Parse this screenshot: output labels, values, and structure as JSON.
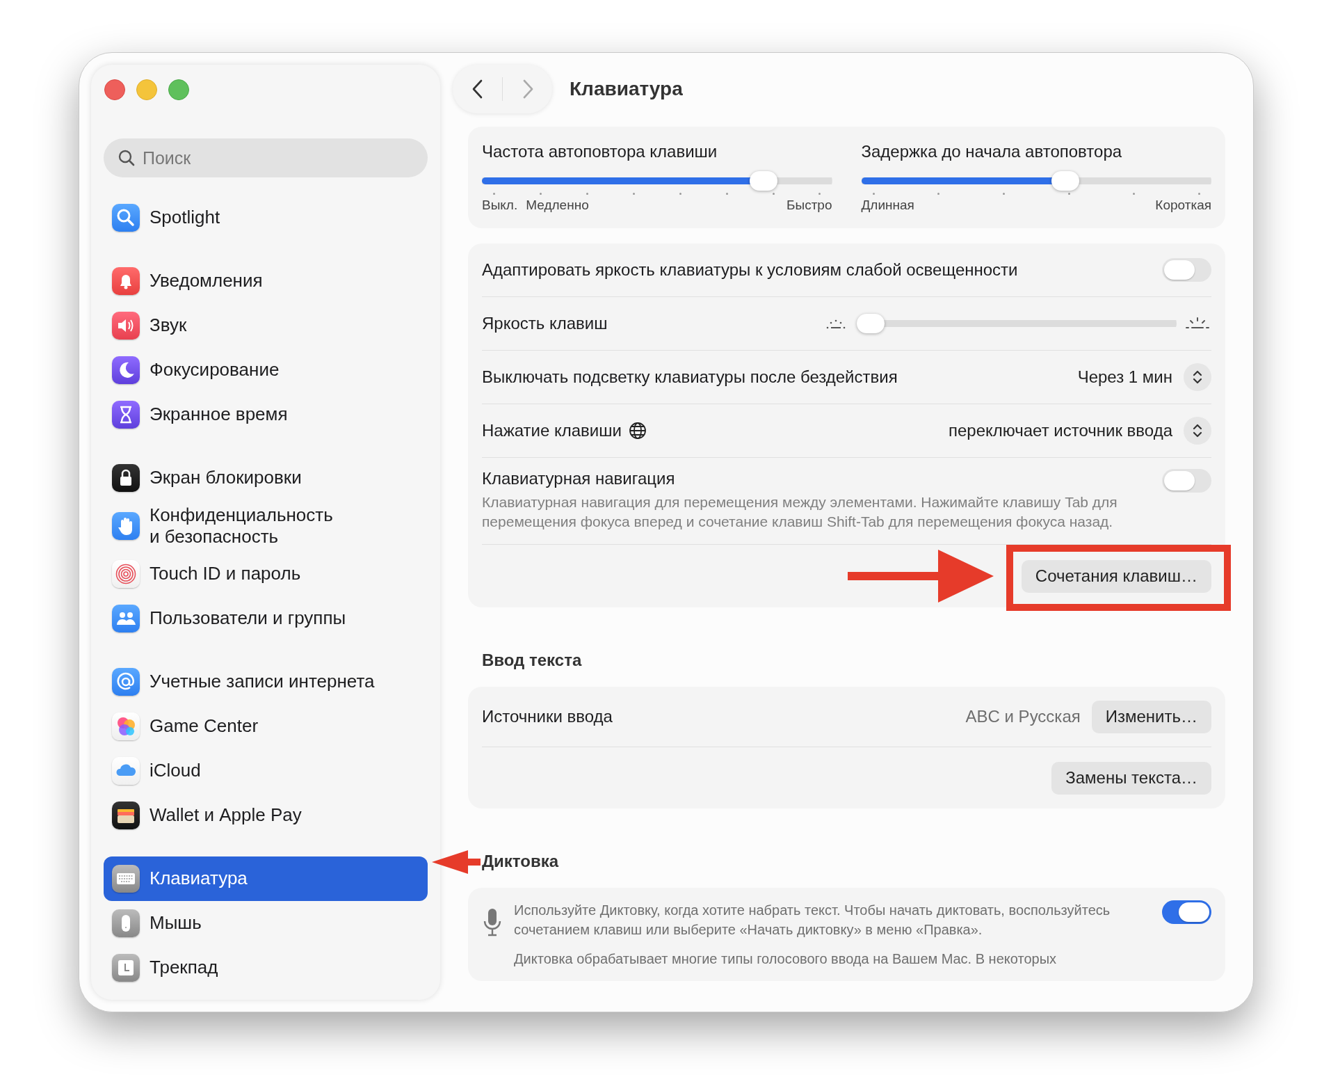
{
  "window": {
    "title": "Клавиатура"
  },
  "sidebar": {
    "search": {
      "placeholder": "Поиск"
    },
    "groups": [
      [
        {
          "label": "Spotlight",
          "kind": "spotlight",
          "selected": false
        }
      ],
      [
        {
          "label": "Уведомления",
          "kind": "notifications",
          "selected": false
        },
        {
          "label": "Звук",
          "kind": "sound",
          "selected": false
        },
        {
          "label": "Фокусирование",
          "kind": "focus",
          "selected": false
        },
        {
          "label": "Экранное время",
          "kind": "screentime",
          "selected": false
        }
      ],
      [
        {
          "label": "Экран блокировки",
          "kind": "lock",
          "selected": false
        },
        {
          "label": "Конфиденциальность\nи безопасность",
          "kind": "privacy",
          "selected": false
        },
        {
          "label": "Touch ID и пароль",
          "kind": "touchid",
          "selected": false
        },
        {
          "label": "Пользователи и группы",
          "kind": "users",
          "selected": false
        }
      ],
      [
        {
          "label": "Учетные записи интернета",
          "kind": "accounts",
          "selected": false
        },
        {
          "label": "Game Center",
          "kind": "gamecenter",
          "selected": false
        },
        {
          "label": "iCloud",
          "kind": "icloud",
          "selected": false
        },
        {
          "label": "Wallet и Apple Pay",
          "kind": "wallet",
          "selected": false
        }
      ],
      [
        {
          "label": "Клавиатура",
          "kind": "keyboard",
          "selected": true
        },
        {
          "label": "Мышь",
          "kind": "mouse",
          "selected": false
        },
        {
          "label": "Трекпад",
          "kind": "trackpad",
          "selected": false
        }
      ]
    ]
  },
  "repeat_panel": {
    "sliders": [
      {
        "title": "Частота автоповтора клавиши",
        "level": 0.83,
        "left_labels": [
          "Выкл.",
          "Медленно"
        ],
        "right_label": "Быстро"
      },
      {
        "title": "Задержка до начала автоповтора",
        "level": 0.59,
        "left_labels": [
          "Длинная"
        ],
        "right_label": "Короткая"
      }
    ]
  },
  "keyboard_panel": {
    "rows": [
      {
        "kind": "toggle",
        "label": "Адаптировать яркость клавиатуры к условиям слабой освещенности",
        "on": false
      },
      {
        "kind": "slider",
        "label": "Яркость клавиш",
        "level": 0
      },
      {
        "kind": "popup",
        "label": "Выключать подсветку клавиатуры после бездействия",
        "value": "Через 1 мин"
      },
      {
        "kind": "globepopup",
        "label": "Нажатие клавиши",
        "value": "переключает источник ввода"
      },
      {
        "kind": "toggle",
        "label": "Клавиатурная навигация",
        "on": false,
        "description": "Клавиатурная навигация для перемещения между элементами. Нажимайте клавишу Tab для перемещения фокуса вперед и сочетание клавиш Shift-Tab для перемещения фокуса назад."
      },
      {
        "kind": "button",
        "button": "Сочетания клавиш…"
      }
    ]
  },
  "text_input": {
    "heading": "Ввод текста",
    "rows": [
      {
        "kind": "valuebutton",
        "label": "Источники ввода",
        "value": "ABC и Русская",
        "button": "Изменить…"
      },
      {
        "kind": "button",
        "button": "Замены текста…"
      }
    ]
  },
  "dictation": {
    "heading": "Диктовка",
    "description": "Используйте Диктовку, когда хотите набрать текст. Чтобы начать диктовать, воспользуйтесь сочетанием клавиш или выберите «Начать диктовку» в меню «Правка».",
    "on": true,
    "note": "Диктовка обрабатывает многие типы голосового ввода на Вашем Mac. В некоторых"
  }
}
